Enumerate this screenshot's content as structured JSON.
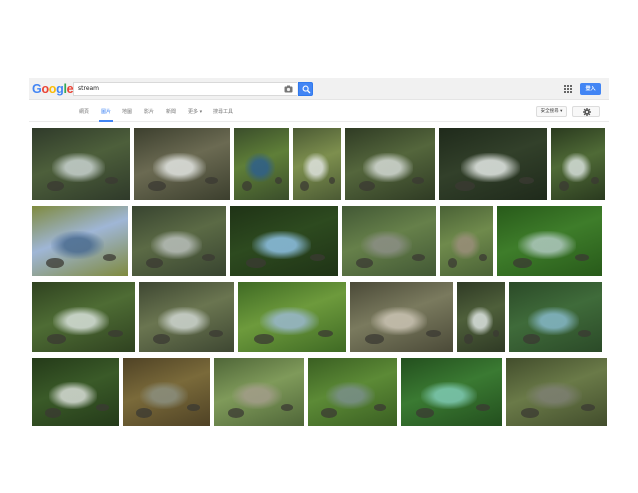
{
  "search": {
    "query": "stream"
  },
  "header": {
    "logo_letters": [
      {
        "char": "G",
        "color": "#4285f4"
      },
      {
        "char": "o",
        "color": "#ea4335"
      },
      {
        "char": "o",
        "color": "#fbbc05"
      },
      {
        "char": "g",
        "color": "#4285f4"
      },
      {
        "char": "l",
        "color": "#34a853"
      },
      {
        "char": "e",
        "color": "#ea4335"
      }
    ],
    "signin_label": "登入"
  },
  "tabs": [
    {
      "label": "網頁",
      "active": false
    },
    {
      "label": "圖片",
      "active": true
    },
    {
      "label": "地圖",
      "active": false
    },
    {
      "label": "影片",
      "active": false
    },
    {
      "label": "新聞",
      "active": false
    },
    {
      "label": "更多 ▾",
      "active": false
    },
    {
      "label": "搜尋工具",
      "active": false
    }
  ],
  "safe_search_label": "安全搜尋 ▾",
  "colors": {
    "accent": "#4285f4"
  },
  "results": [
    {
      "row": 0,
      "palette": [
        "#4d5f3b",
        "#c9d3d0",
        "#2f3a2a"
      ]
    },
    {
      "row": 0,
      "palette": [
        "#6b6a52",
        "#e3e6e3",
        "#3c3f2e"
      ]
    },
    {
      "row": 0,
      "palette": [
        "#5f7f38",
        "#2e5f8c",
        "#3a4d2b"
      ]
    },
    {
      "row": 0,
      "palette": [
        "#7d8f4e",
        "#dfe3df",
        "#4b5a34"
      ]
    },
    {
      "row": 0,
      "palette": [
        "#54663c",
        "#d5dbd6",
        "#2f3b24"
      ]
    },
    {
      "row": 0,
      "palette": [
        "#32402a",
        "#e6ebe8",
        "#1f2a1b"
      ]
    },
    {
      "row": 0,
      "palette": [
        "#4f6a36",
        "#d7e0db",
        "#2a3a1f"
      ]
    },
    {
      "row": 1,
      "palette": [
        "#9fb6d6",
        "#4a6b8f",
        "#7f8a3e"
      ]
    },
    {
      "row": 1,
      "palette": [
        "#5b6a45",
        "#b9bfbb",
        "#384430"
      ]
    },
    {
      "row": 1,
      "palette": [
        "#2d4a1f",
        "#8fc2e6",
        "#1f3316"
      ]
    },
    {
      "row": 1,
      "palette": [
        "#66804a",
        "#8c8f86",
        "#425835"
      ]
    },
    {
      "row": 1,
      "palette": [
        "#6f8a4c",
        "#9a8e7a",
        "#4a6236"
      ]
    },
    {
      "row": 1,
      "palette": [
        "#3e7d2a",
        "#b0c9c0",
        "#285a1a"
      ]
    },
    {
      "row": 2,
      "palette": [
        "#4e6c34",
        "#d9e2dc",
        "#2f4220"
      ]
    },
    {
      "row": 2,
      "palette": [
        "#6a7550",
        "#cfd6d1",
        "#3e4732"
      ]
    },
    {
      "row": 2,
      "palette": [
        "#6d9a3c",
        "#9ab8cf",
        "#3f6a24"
      ]
    },
    {
      "row": 2,
      "palette": [
        "#7a7a5e",
        "#cbc4b4",
        "#4b4a38"
      ]
    },
    {
      "row": 2,
      "palette": [
        "#4e5f3a",
        "#dde4e1",
        "#2f3a25"
      ]
    },
    {
      "row": 2,
      "palette": [
        "#3f6b3a",
        "#86b8c9",
        "#2b4a28"
      ]
    },
    {
      "row": 3,
      "palette": [
        "#3a5a28",
        "#d9ded8",
        "#243a19"
      ]
    },
    {
      "row": 3,
      "palette": [
        "#7a6a3a",
        "#8b8f7f",
        "#4f4225"
      ]
    },
    {
      "row": 3,
      "palette": [
        "#7f9a5a",
        "#a39d8a",
        "#4f6638"
      ]
    },
    {
      "row": 3,
      "palette": [
        "#5c8a36",
        "#7a8f8a",
        "#3a5f22"
      ]
    },
    {
      "row": 3,
      "palette": [
        "#3a7a32",
        "#7fcab4",
        "#234f1e"
      ]
    },
    {
      "row": 3,
      "palette": [
        "#6a7a48",
        "#7d7f72",
        "#424d2c"
      ]
    }
  ]
}
